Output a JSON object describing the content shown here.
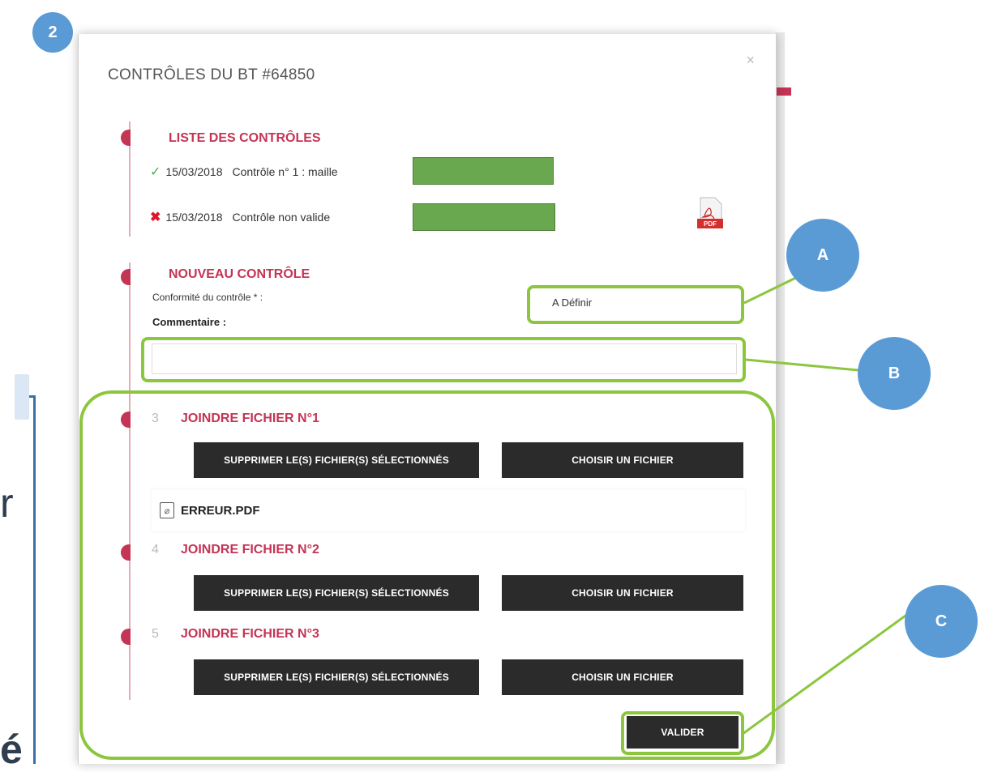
{
  "step_badge": "2",
  "modal": {
    "title": "CONTRÔLES DU BT #64850",
    "close": "×",
    "list_section_title": "LISTE DES CONTRÔLES",
    "controls": [
      {
        "status": "valid",
        "date": "15/03/2018",
        "label": "Contrôle n° 1 : maille"
      },
      {
        "status": "invalid",
        "date": "15/03/2018",
        "label": "Contrôle non valide"
      }
    ],
    "pdf_icon_label": "PDF",
    "new_section_title": "NOUVEAU CONTRÔLE",
    "conformity_label": "Conformité du contrôle * :",
    "conformity_value": "A Définir",
    "comment_label": "Commentaire :",
    "comment_value": "",
    "attachments": [
      {
        "num": "3",
        "title": "JOINDRE FICHIER N°1",
        "delete_label": "SUPPRIMER LE(S) FICHIER(S) SÉLECTIONNÉS",
        "choose_label": "CHOISIR UN FICHIER",
        "file": "ERREUR.PDF"
      },
      {
        "num": "4",
        "title": "JOINDRE FICHIER N°2",
        "delete_label": "SUPPRIMER LE(S) FICHIER(S) SÉLECTIONNÉS",
        "choose_label": "CHOISIR UN FICHIER"
      },
      {
        "num": "5",
        "title": "JOINDRE FICHIER N°3",
        "delete_label": "SUPPRIMER LE(S) FICHIER(S) SÉLECTIONNÉS",
        "choose_label": "CHOISIR UN FICHIER"
      }
    ],
    "submit_label": "VALIDER"
  },
  "callouts": {
    "a": "A",
    "b": "B",
    "c": "C"
  },
  "background": {
    "left_letter_1": "r",
    "left_letter_2": "é"
  },
  "colors": {
    "accent": "#c43455",
    "callout": "#5b9bd5",
    "highlight": "#8cc63f",
    "button": "#2b2b2b"
  }
}
